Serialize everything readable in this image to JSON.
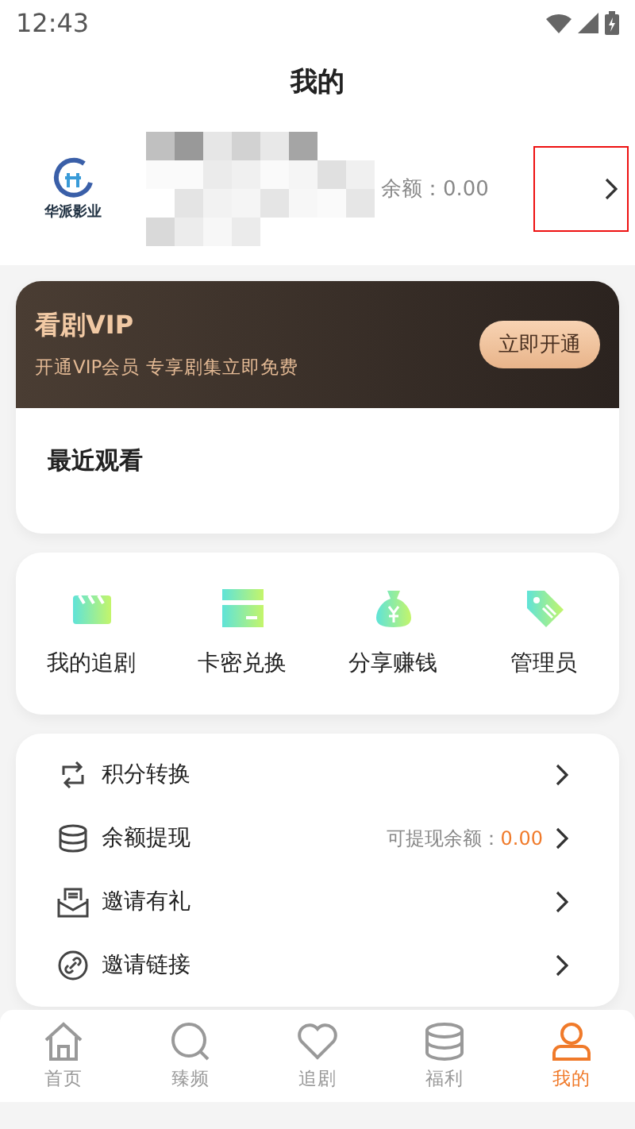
{
  "status_bar": {
    "time": "12:43"
  },
  "title": "我的",
  "profile": {
    "logo_text": "华派影业",
    "balance": "余额：0.00",
    "highlighted": true
  },
  "vip": {
    "title": "看剧VIP",
    "subtitle": "开通VIP会员 专享剧集立即免费",
    "button": "立即开通"
  },
  "recent": {
    "title": "最近观看"
  },
  "shortcuts": [
    {
      "kind": "clapper",
      "label": "我的追剧"
    },
    {
      "kind": "card",
      "label": "卡密兑换"
    },
    {
      "kind": "moneybag",
      "label": "分享赚钱"
    },
    {
      "kind": "tag",
      "label": "管理员"
    }
  ],
  "menu": [
    {
      "kind": "exchange",
      "label": "积分转换"
    },
    {
      "kind": "coins",
      "label": "余额提现",
      "note": "可提现余额：",
      "value": "0.00"
    },
    {
      "kind": "mail",
      "label": "邀请有礼"
    },
    {
      "kind": "link",
      "label": "邀请链接"
    }
  ],
  "tabs": [
    {
      "kind": "home",
      "label": "首页",
      "selected": false
    },
    {
      "kind": "search",
      "label": "臻频",
      "selected": false
    },
    {
      "kind": "heart",
      "label": "追剧",
      "selected": false
    },
    {
      "kind": "coins",
      "label": "福利",
      "selected": false
    },
    {
      "kind": "user",
      "label": "我的",
      "selected": true
    }
  ]
}
